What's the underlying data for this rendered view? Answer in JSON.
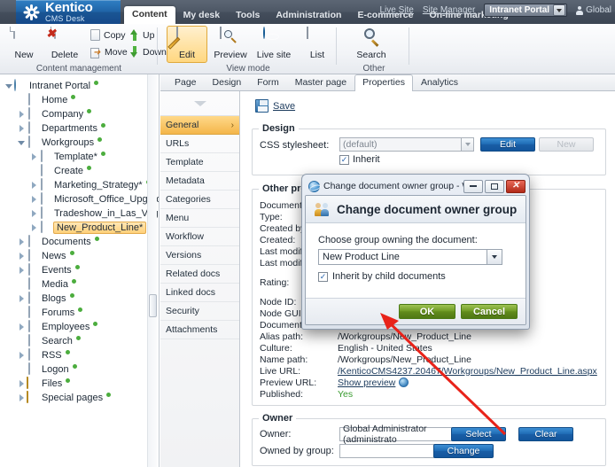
{
  "header": {
    "logo_line1": "Kentico",
    "logo_line2": "CMS Desk",
    "tabs": [
      {
        "label": "Content",
        "active": true
      },
      {
        "label": "My desk",
        "active": false
      },
      {
        "label": "Tools",
        "active": false
      },
      {
        "label": "Administration",
        "active": false
      },
      {
        "label": "E-commerce",
        "active": false
      },
      {
        "label": "On-line marketing",
        "active": false
      }
    ],
    "live_site_link": "Live Site",
    "site_manager_link": "Site Manager",
    "site_selector_value": "Intranet Portal",
    "user_label": "Global"
  },
  "ribbon": {
    "groups": [
      {
        "label": "Content management"
      },
      {
        "label": "View mode"
      },
      {
        "label": "Other"
      }
    ],
    "buttons": {
      "new": "New",
      "delete": "Delete",
      "copy": "Copy",
      "move": "Move",
      "up": "Up",
      "down": "Down",
      "edit": "Edit",
      "preview": "Preview",
      "live_site": "Live site",
      "list": "List",
      "search": "Search"
    }
  },
  "tree": [
    {
      "label": "Intranet Portal",
      "depth": 0,
      "icon": "world-icon",
      "expander": "down",
      "dot": true,
      "selected": false,
      "star": false
    },
    {
      "label": "Home",
      "depth": 1,
      "icon": "page-icon",
      "expander": "none",
      "dot": true,
      "selected": false,
      "star": false
    },
    {
      "label": "Company",
      "depth": 1,
      "icon": "page-icon",
      "expander": "right",
      "dot": true,
      "selected": false,
      "star": false
    },
    {
      "label": "Departments",
      "depth": 1,
      "icon": "page-icon",
      "expander": "right",
      "dot": true,
      "selected": false,
      "star": false
    },
    {
      "label": "Workgroups",
      "depth": 1,
      "icon": "page-icon",
      "expander": "down",
      "dot": true,
      "selected": false,
      "star": false
    },
    {
      "label": "Template*",
      "depth": 2,
      "icon": "page-icon",
      "expander": "right",
      "dot": true,
      "selected": false,
      "star": true
    },
    {
      "label": "Create",
      "depth": 2,
      "icon": "page-icon",
      "expander": "none",
      "dot": true,
      "selected": false,
      "star": false
    },
    {
      "label": "Marketing_Strategy*",
      "depth": 2,
      "icon": "page-icon",
      "expander": "right",
      "dot": true,
      "selected": false,
      "star": true
    },
    {
      "label": "Microsoft_Office_Upgrade*",
      "depth": 2,
      "icon": "page-icon",
      "expander": "right",
      "dot": true,
      "selected": false,
      "star": true
    },
    {
      "label": "Tradeshow_in_Las_Vegas*",
      "depth": 2,
      "icon": "page-icon",
      "expander": "right",
      "dot": true,
      "selected": false,
      "star": true
    },
    {
      "label": "New_Product_Line*",
      "depth": 2,
      "icon": "page-icon",
      "expander": "right",
      "dot": true,
      "selected": true,
      "star": true
    },
    {
      "label": "Documents",
      "depth": 1,
      "icon": "page-icon",
      "expander": "right",
      "dot": true,
      "selected": false,
      "star": false
    },
    {
      "label": "News",
      "depth": 1,
      "icon": "page-icon",
      "expander": "right",
      "dot": true,
      "selected": false,
      "star": false
    },
    {
      "label": "Events",
      "depth": 1,
      "icon": "page-icon",
      "expander": "right",
      "dot": true,
      "selected": false,
      "star": false
    },
    {
      "label": "Media",
      "depth": 1,
      "icon": "page-icon",
      "expander": "none",
      "dot": true,
      "selected": false,
      "star": false
    },
    {
      "label": "Blogs",
      "depth": 1,
      "icon": "page-icon",
      "expander": "right",
      "dot": true,
      "selected": false,
      "star": false
    },
    {
      "label": "Forums",
      "depth": 1,
      "icon": "page-icon",
      "expander": "none",
      "dot": true,
      "selected": false,
      "star": false
    },
    {
      "label": "Employees",
      "depth": 1,
      "icon": "page-icon",
      "expander": "right",
      "dot": true,
      "selected": false,
      "star": false
    },
    {
      "label": "Search",
      "depth": 1,
      "icon": "page-icon",
      "expander": "none",
      "dot": true,
      "selected": false,
      "star": false
    },
    {
      "label": "RSS",
      "depth": 1,
      "icon": "page-icon",
      "expander": "right",
      "dot": true,
      "selected": false,
      "star": false
    },
    {
      "label": "Logon",
      "depth": 1,
      "icon": "page-icon",
      "expander": "none",
      "dot": true,
      "selected": false,
      "star": false
    },
    {
      "label": "Files",
      "depth": 1,
      "icon": "folder-icon",
      "expander": "right",
      "dot": true,
      "selected": false,
      "star": false
    },
    {
      "label": "Special pages",
      "depth": 1,
      "icon": "folder-icon",
      "expander": "right",
      "dot": true,
      "selected": false,
      "star": false
    }
  ],
  "content_tabs": [
    {
      "label": "Page",
      "active": false
    },
    {
      "label": "Design",
      "active": false
    },
    {
      "label": "Form",
      "active": false
    },
    {
      "label": "Master page",
      "active": false
    },
    {
      "label": "Properties",
      "active": true
    },
    {
      "label": "Analytics",
      "active": false
    }
  ],
  "properties_menu": [
    {
      "label": "General",
      "active": true
    },
    {
      "label": "URLs",
      "active": false
    },
    {
      "label": "Template",
      "active": false
    },
    {
      "label": "Metadata",
      "active": false
    },
    {
      "label": "Categories",
      "active": false
    },
    {
      "label": "Menu",
      "active": false
    },
    {
      "label": "Workflow",
      "active": false
    },
    {
      "label": "Versions",
      "active": false
    },
    {
      "label": "Related docs",
      "active": false
    },
    {
      "label": "Linked docs",
      "active": false
    },
    {
      "label": "Security",
      "active": false
    },
    {
      "label": "Attachments",
      "active": false
    }
  ],
  "panel": {
    "save_label": "Save",
    "design": {
      "legend": "Design",
      "css_label": "CSS stylesheet:",
      "css_value": "(default)",
      "edit_button": "Edit",
      "new_button": "New",
      "inherit_label": "Inherit",
      "inherit_checked": true
    },
    "other_properties": {
      "legend": "Other properties",
      "rows": [
        {
          "key": "Document name:",
          "value": ""
        },
        {
          "key": "Type:",
          "value": ""
        },
        {
          "key": "Created by:",
          "value": ""
        },
        {
          "key": "Created:",
          "value": ""
        },
        {
          "key": "Last modified by:",
          "value": ""
        },
        {
          "key": "Last modified:",
          "value": ""
        },
        {
          "key": "",
          "value": ""
        },
        {
          "key": "Rating:",
          "value": ""
        },
        {
          "key": "",
          "value": ""
        },
        {
          "key": "Node ID:",
          "value": ""
        },
        {
          "key": "Node GUID:",
          "value": ""
        },
        {
          "key": "Document GUID:",
          "value": ""
        },
        {
          "key": "Alias path:",
          "value": "/Workgroups/New_Product_Line"
        },
        {
          "key": "Culture:",
          "value": "English - United States"
        },
        {
          "key": "Name path:",
          "value": "/Workgroups/New_Product_Line"
        },
        {
          "key": "Live URL:",
          "value": "/KenticoCMS4237.20467/Workgroups/New_Product_Line.aspx",
          "style": "link"
        },
        {
          "key": "Preview URL:",
          "value": "Show preview",
          "style": "link",
          "icon": "preview-icon"
        },
        {
          "key": "Published:",
          "value": "Yes",
          "style": "green"
        }
      ]
    },
    "owner": {
      "legend": "Owner",
      "owner_label": "Owner:",
      "owner_value": "Global Administrator (administrato",
      "select_button": "Select",
      "clear_button": "Clear",
      "group_label": "Owned by group:",
      "group_value": "",
      "change_button": "Change"
    }
  },
  "dialog": {
    "window_title": "Change document owner group - Windo...",
    "heading": "Change document owner group",
    "prompt": "Choose group owning the document:",
    "combo_value": "New Product Line",
    "inherit_label": "Inherit by child documents",
    "inherit_checked": true,
    "ok_button": "OK",
    "cancel_button": "Cancel",
    "minimize_title": "Minimize",
    "maximize_title": "Maximize",
    "close_title": "Close"
  },
  "colors": {
    "brand_blue": "#1f63a6",
    "header_slate": "#4d5765",
    "accent_orange": "#f4b64a",
    "button_blue": "#1f6cb5",
    "button_green": "#6e9a24",
    "annotation_red": "#e8231a",
    "published_green": "#3a9b30"
  }
}
